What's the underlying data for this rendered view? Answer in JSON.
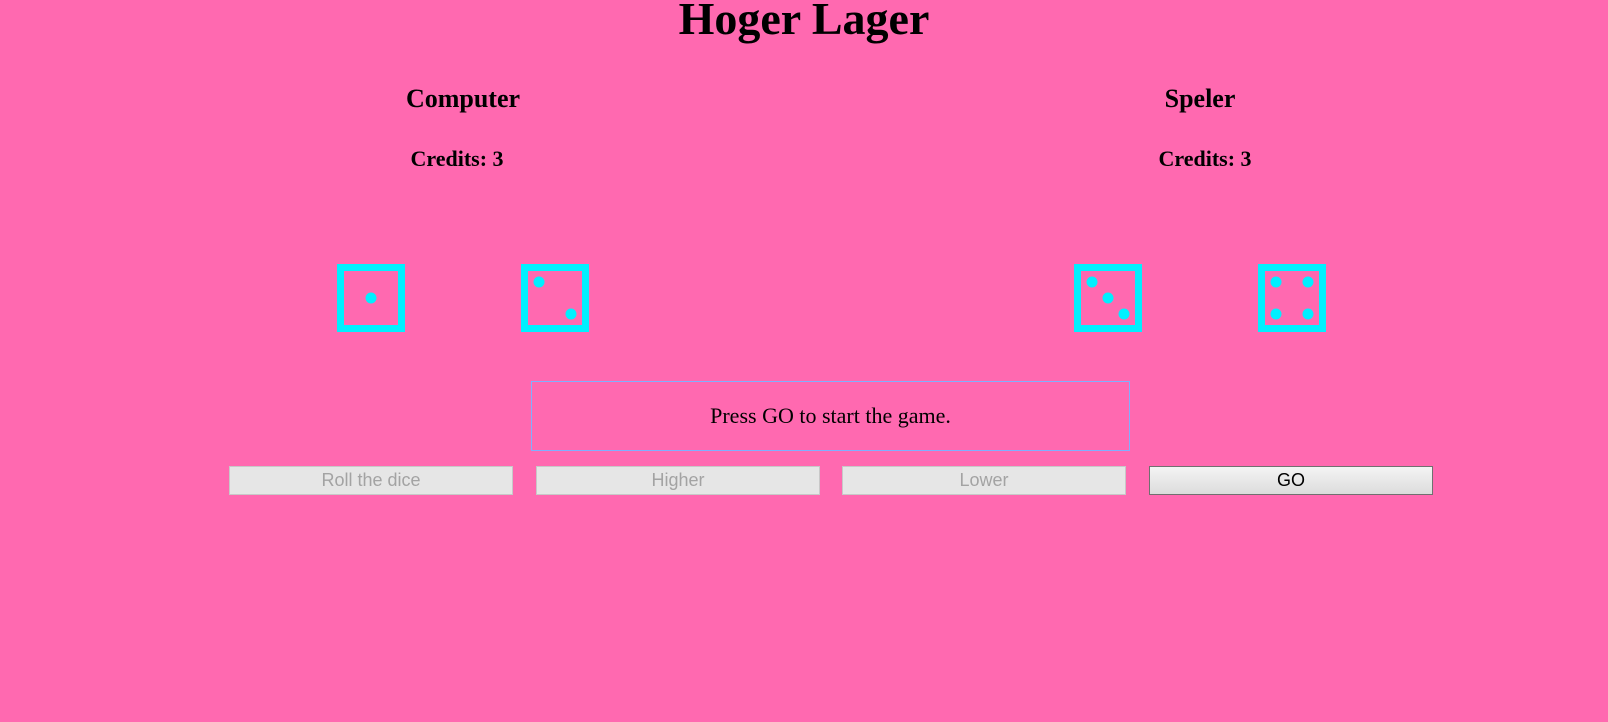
{
  "title": "Hoger Lager",
  "computer": {
    "name": "Computer",
    "credits": "Credits: 3",
    "dice": [
      1,
      2
    ]
  },
  "player": {
    "name": "Speler",
    "credits": "Credits: 3",
    "dice": [
      3,
      4
    ]
  },
  "message": "Press GO to start the game.",
  "buttons": {
    "roll": "Roll the dice",
    "higher": "Higher",
    "lower": "Lower",
    "go": "GO"
  },
  "colors": {
    "background": "#ff69b0",
    "dice": "#00f0ff"
  }
}
